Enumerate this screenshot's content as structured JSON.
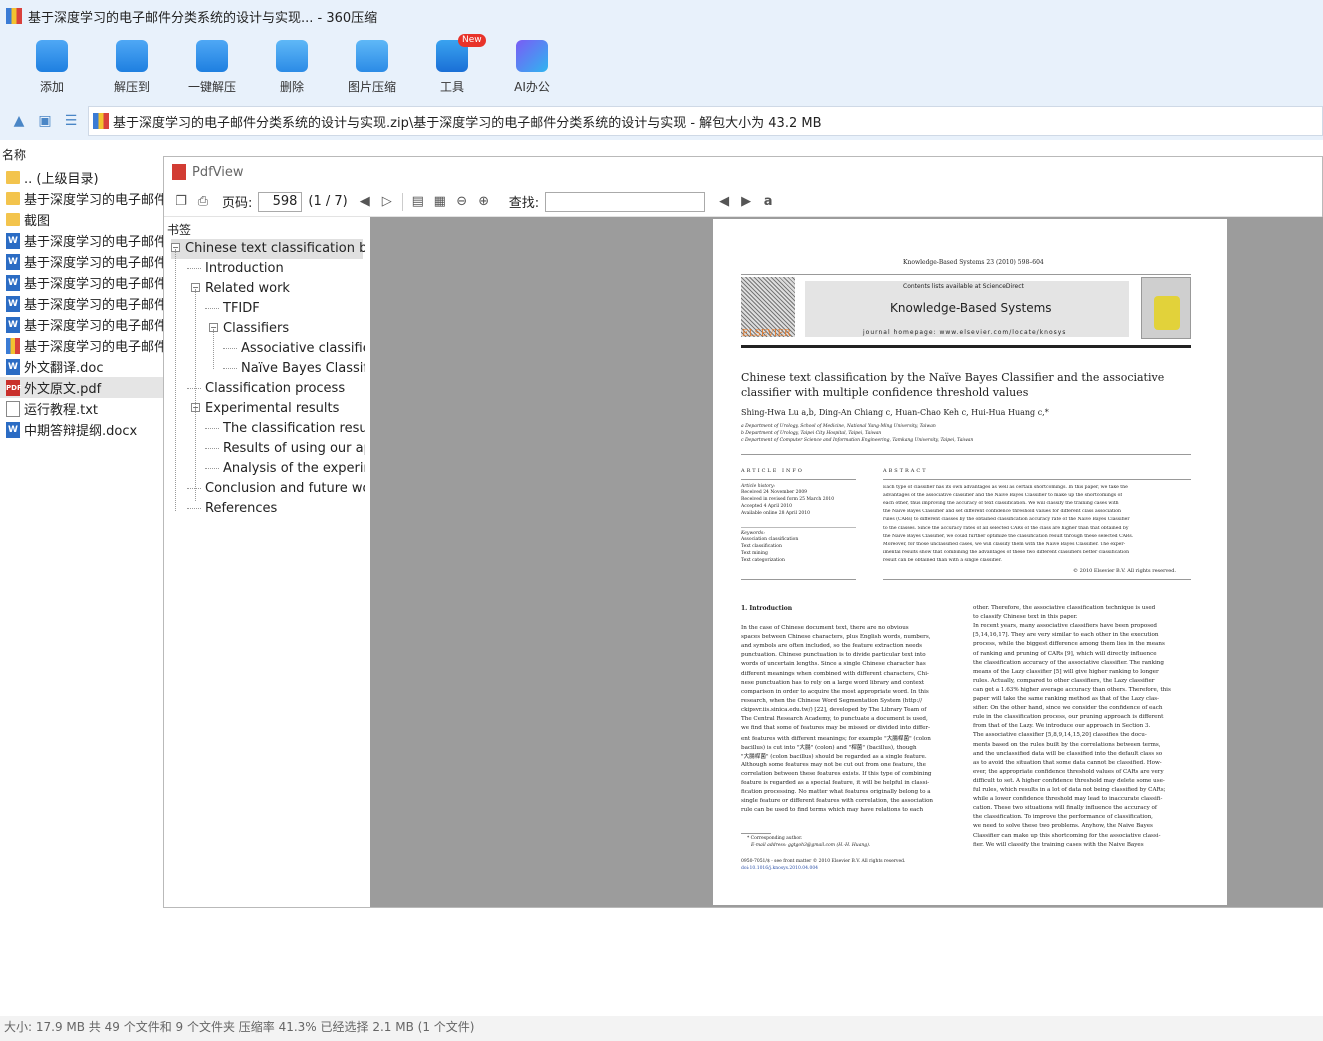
{
  "window": {
    "title": "基于深度学习的电子邮件分类系统的设计与实现... - 360压缩"
  },
  "toolbar": [
    {
      "label": "添加",
      "icon": "add-icon"
    },
    {
      "label": "解压到",
      "icon": "extract-to-icon"
    },
    {
      "label": "一键解压",
      "icon": "one-click-extract-icon"
    },
    {
      "label": "删除",
      "icon": "delete-icon"
    },
    {
      "label": "图片压缩",
      "icon": "image-compress-icon"
    },
    {
      "label": "工具",
      "icon": "tools-icon",
      "badge": "New"
    },
    {
      "label": "AI办公",
      "icon": "ai-office-icon"
    }
  ],
  "address": "基于深度学习的电子邮件分类系统的设计与实现.zip\\基于深度学习的电子邮件分类系统的设计与实现 - 解包大小为 43.2 MB",
  "filelist": {
    "header": "名称",
    "items": [
      {
        "name": ".. (上级目录)",
        "type": "folder"
      },
      {
        "name": "基于深度学习的电子邮件分类系统",
        "type": "folder"
      },
      {
        "name": "截图",
        "type": "folder"
      },
      {
        "name": "基于深度学习的电子邮件分类系统",
        "type": "doc"
      },
      {
        "name": "基于深度学习的电子邮件分类系统",
        "type": "doc"
      },
      {
        "name": "基于深度学习的电子邮件分类系统",
        "type": "doc"
      },
      {
        "name": "基于深度学习的电子邮件分类系统",
        "type": "doc"
      },
      {
        "name": "基于深度学习的电子邮件分类系统",
        "type": "doc"
      },
      {
        "name": "基于深度学习的电子邮件分类系统",
        "type": "zip"
      },
      {
        "name": "外文翻译.doc",
        "type": "doc"
      },
      {
        "name": "外文原文.pdf",
        "type": "pdf",
        "selected": true
      },
      {
        "name": "运行教程.txt",
        "type": "txt"
      },
      {
        "name": "中期答辩提纲.docx",
        "type": "doc"
      }
    ]
  },
  "pdfview": {
    "title": "PdfView",
    "page_label": "页码:",
    "page_value": "598",
    "page_count": "(1 / 7)",
    "find_label": "查找:",
    "bookmarks_label": "书签",
    "bookmarks": [
      {
        "label": "Chinese text classification by th",
        "level": 0,
        "toggle": "−"
      },
      {
        "label": "Introduction",
        "level": 1
      },
      {
        "label": "Related work",
        "level": 1,
        "toggle": "−"
      },
      {
        "label": "TFIDF",
        "level": 2
      },
      {
        "label": "Classifiers",
        "level": 2,
        "toggle": "−"
      },
      {
        "label": "Associative classifier",
        "level": 3
      },
      {
        "label": "Naïve Bayes Classifie",
        "level": 3
      },
      {
        "label": "Classification process",
        "level": 1
      },
      {
        "label": "Experimental results",
        "level": 1,
        "toggle": "−"
      },
      {
        "label": "The classification results",
        "level": 2
      },
      {
        "label": "Results of using our app",
        "level": 2
      },
      {
        "label": "Analysis of the experime",
        "level": 2
      },
      {
        "label": "Conclusion and future work",
        "level": 1
      },
      {
        "label": "References",
        "level": 1
      }
    ]
  },
  "paper": {
    "journal_ref": "Knowledge-Based Systems 23 (2010) 598–604",
    "contents_line": "Contents lists available at ScienceDirect",
    "journal_name": "Knowledge-Based Systems",
    "homepage": "journal homepage: www.elsevier.com/locate/knosys",
    "publisher": "ELSEVIER",
    "title_line1": "Chinese text classification by the Naïve Bayes Classifier and the associative",
    "title_line2": "classifier with multiple confidence threshold values",
    "authors": "Shing-Hwa Lu a,b, Ding-An Chiang c, Huan-Chao Keh c, Hui-Hua Huang c,*",
    "affil1": "a Department of Urology, School of Medicine, National Yang-Ming University, Taiwan",
    "affil2": "b Department of Urology, Taipei City Hospital, Taipei, Taiwan",
    "affil3": "c Department of Computer Science and Information Engineering, Tamkang University, Taipei, Taiwan",
    "article_info": "ARTICLE INFO",
    "abstract_head": "ABSTRACT",
    "history_head": "Article history:",
    "history": [
      "Received 24 November 2009",
      "Received in revised form 25 March 2010",
      "Accepted 4 April 2010",
      "Available online 28 April 2010"
    ],
    "keywords_head": "Keywords:",
    "keywords": [
      "Association classification",
      "Text classification",
      "Text mining",
      "Text categorization"
    ],
    "abstract_lines": [
      "Each type of classifier has its own advantages as well as certain shortcomings. In this paper, we take the",
      "advantages of the associative classifier and the Naive Bayes Classifier to make up the shortcomings of",
      "each other, thus improving the accuracy of text classification. We will classify the training cases with",
      "the Naive Bayes Classifier and set different confidence threshold values for different class association",
      "rules (CARs) to different classes by the obtained classification accuracy rate of the Naive Bayes Classifier",
      "to the classes. Since the accuracy rates of all selected CARs of the class are higher than that obtained by",
      "the Naive Bayes Classifier, we could further optimize the classification result through these selected CARs.",
      "Moreover, for those unclassified cases, we will classify them with the Naive Bayes Classifier. The exper-",
      "imental results show that combining the advantages of these two different classifiers better classification",
      "result can be obtained than with a single classifier."
    ],
    "copyright": "© 2010 Elsevier B.V. All rights reserved.",
    "intro_head": "1. Introduction",
    "left_col": [
      "In the case of Chinese document text, there are no obvious",
      "spaces between Chinese characters, plus English words, numbers,",
      "and symbols are often included, so the feature extraction needs",
      "punctuation. Chinese punctuation is to divide particular text into",
      "words of uncertain lengths. Since a single Chinese character has",
      "different meanings when combined with different characters, Chi-",
      "nese punctuation has to rely on a large word library and context",
      "comparison in order to acquire the most appropriate word. In this",
      "research, when the Chinese Word Segmentation System (http://",
      "ckipsvr.iis.sinica.edu.tw/) [22], developed by The Library Team of",
      "The Central Research Academy, to punctuate a document is used,",
      "we find that some of features may be missed or divided into differ-",
      "ent features with different meanings; for example \"大腸桿菌\" (colon",
      "bacillus) is cut into \"大腸\" (colon) and \"桿菌\" (bacillus), though",
      "\"大腸桿菌\" (colon bacillus) should be regarded as a single feature.",
      "Although some features may not be cut out from one feature, the",
      "correlation between these features exists. If this type of combining",
      "feature is regarded as a special feature, it will be helpful in classi-",
      "fication processing. No matter what features originally belong to a",
      "single feature or different features with correlation, the association",
      "rule can be used to find terms which may have relations to each"
    ],
    "right_col": [
      "other. Therefore, the associative classification technique is used",
      "to classify Chinese text in this paper.",
      "In recent years, many associative classifiers have been proposed",
      "[5,14,16,17]. They are very similar to each other in the execution",
      "process, while the biggest difference among them lies in the means",
      "of ranking and pruning of CARs [9], which will directly influence",
      "the classification accuracy of the associative classifier. The ranking",
      "means of the Lazy classifier [5] will give higher ranking to longer",
      "rules. Actually, compared to other classifiers, the Lazy classifier",
      "can get a 1.63% higher average accuracy than others. Therefore, this",
      "paper will take the same ranking method as that of the Lazy clas-",
      "sifier. On the other hand, since we consider the confidence of each",
      "rule in the classification process, our pruning approach is different",
      "from that of the Lazy. We introduce our approach in Section 3.",
      "The associative classifier [5,8,9,14,15,20] classifies the docu-",
      "ments based on the rules built by the correlations between terms,",
      "and the unclassified data will be classified into the default class so",
      "as to avoid the situation that some data cannot be classified. How-",
      "ever, the appropriate confidence threshold values of CARs are very",
      "difficult to set. A higher confidence threshold may delete some use-",
      "ful rules, which results in a lot of data not being classified by CARs;",
      "while a lower confidence threshold may lead to inaccurate classifi-",
      "cation. These two situations will finally influence the accuracy of",
      "the classification. To improve the performance of classification,",
      "we need to solve these two problems. Anyhow, the Naive Bayes",
      "Classifier can make up this shortcoming for the associative classi-",
      "fier. We will classify the training cases with the Naive Bayes"
    ],
    "footnote1": "* Corresponding author.",
    "footnote2": "E-mail address: ggtgoh3@gmail.com (H.-H. Huang).",
    "footer1": "0950-7051/$ - see front matter © 2010 Elsevier B.V. All rights reserved.",
    "footer2": "doi:10.1016/j.knosys.2010.04.004"
  },
  "status": "大小: 17.9 MB 共 49 个文件和 9 个文件夹 压缩率 41.3% 已经选择 2.1 MB (1 个文件)"
}
